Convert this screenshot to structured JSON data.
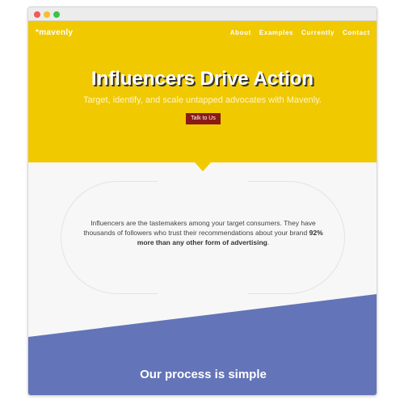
{
  "header": {
    "logo": "*mavenly",
    "nav": [
      "About",
      "Examples",
      "Currently",
      "Contact"
    ]
  },
  "hero": {
    "title": "Influencers Drive Action",
    "subtitle": "Target, identify, and scale untapped advocates with Mavenly.",
    "cta_label": "Talk to Us"
  },
  "info": {
    "text_1": "Influencers are the tastemakers among your target consumers. They have thousands of followers who trust their recommendations about your brand",
    "text_bold": "92% more than any other form of advertising",
    "text_end": "."
  },
  "process": {
    "title": "Our process is simple"
  },
  "colors": {
    "hero_bg": "#f1c900",
    "cta_bg": "#8b1a14",
    "process_bg": "#6374b8"
  }
}
